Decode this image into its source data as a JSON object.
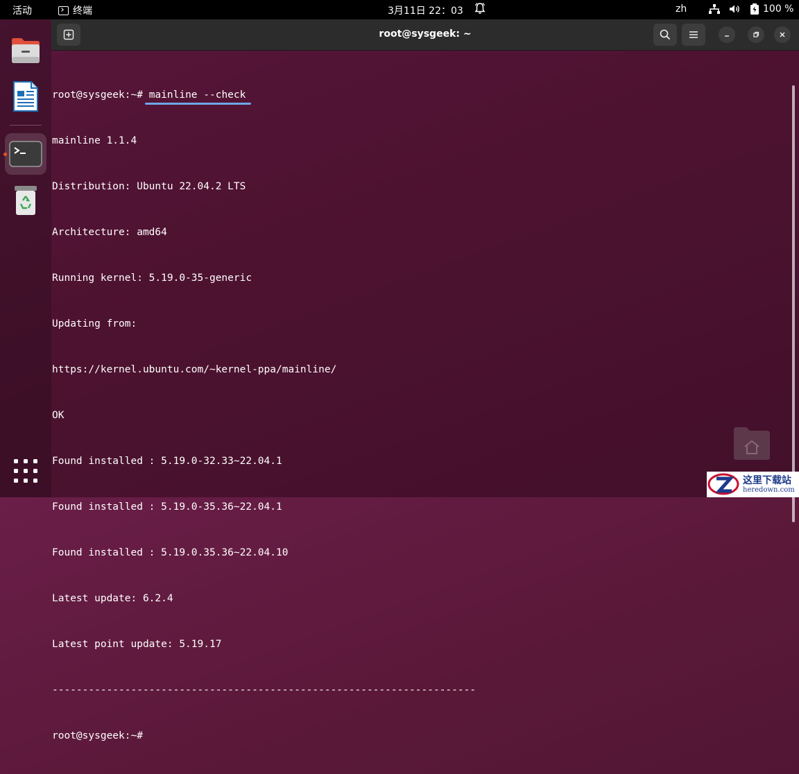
{
  "topbar": {
    "activities": "活动",
    "app_name": "终端",
    "clock": "3月11日  22：03",
    "input_method": "zh",
    "battery": "100 %"
  },
  "dock": {
    "items": [
      {
        "name": "files",
        "icon": "files-icon"
      },
      {
        "name": "libreoffice-writer",
        "icon": "writer-icon"
      },
      {
        "name": "terminal",
        "icon": "terminal-icon",
        "active": true
      },
      {
        "name": "trash",
        "icon": "trash-icon"
      }
    ],
    "show_apps_icon": "apps-grid-icon"
  },
  "window": {
    "title": "root@sysgeek: ~"
  },
  "terminal": {
    "prompt": "root@sysgeek:~#",
    "command": "mainline --check",
    "output": [
      "mainline 1.1.4",
      "Distribution: Ubuntu 22.04.2 LTS",
      "Architecture: amd64",
      "Running kernel: 5.19.0-35-generic",
      "Updating from:",
      "https://kernel.ubuntu.com/~kernel-ppa/mainline/",
      "OK",
      "Found installed : 5.19.0-32.33~22.04.1",
      "Found installed : 5.19.0-35.36~22.04.1",
      "Found installed : 5.19.0.35.36~22.04.10",
      "Latest update: 6.2.4",
      "Latest point update: 5.19.17",
      "----------------------------------------------------------------------"
    ],
    "final_prompt": "root@sysgeek:~#"
  },
  "watermark": {
    "cn": "这里下载站",
    "en": "heredown.com"
  },
  "colors": {
    "accent": "#e95420",
    "underline": "#6ea8e8",
    "headerbar": "#2c2c2c"
  }
}
